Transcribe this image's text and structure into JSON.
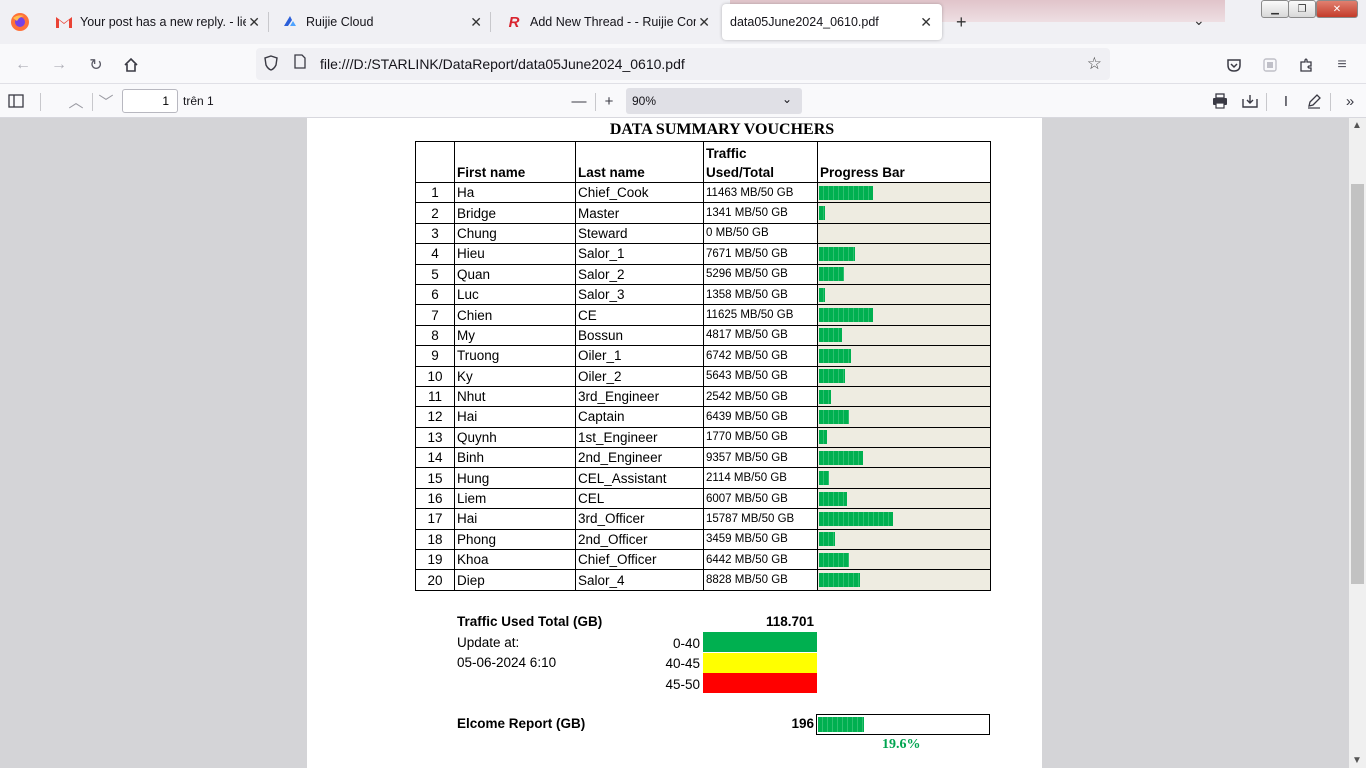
{
  "tabs": [
    {
      "title": "Your post has a new reply. - lien",
      "icon": "gmail-icon"
    },
    {
      "title": "Ruijie Cloud",
      "icon": "ruijie-cloud-icon"
    },
    {
      "title": "Add New Thread - - Ruijie Com",
      "icon": "ruijie-r-icon"
    },
    {
      "title": "data05June2024_0610.pdf",
      "icon": "pdf-icon",
      "active": true
    }
  ],
  "nav": {
    "url": "file:///D:/STARLINK/DataReport/data05June2024_0610.pdf"
  },
  "pdf_toolbar": {
    "page": "1",
    "of_label": "trên 1",
    "zoom": "90%"
  },
  "document": {
    "title": "DATA SUMMARY VOUCHERS",
    "headers": {
      "no": "",
      "first": "First name",
      "last": "Last name",
      "traffic_1": "Traffic",
      "traffic_2": "Used/Total",
      "progress": "Progress Bar"
    },
    "rows": [
      {
        "no": "1",
        "first": "Ha",
        "last": "Chief_Cook",
        "traffic": "11463 MB/50 GB",
        "used_mb": 11463
      },
      {
        "no": "2",
        "first": "Bridge",
        "last": "Master",
        "traffic": "1341 MB/50 GB",
        "used_mb": 1341
      },
      {
        "no": "3",
        "first": "Chung",
        "last": "Steward",
        "traffic": "0 MB/50 GB",
        "used_mb": 0
      },
      {
        "no": "4",
        "first": "Hieu",
        "last": "Salor_1",
        "traffic": "7671 MB/50 GB",
        "used_mb": 7671
      },
      {
        "no": "5",
        "first": "Quan",
        "last": "Salor_2",
        "traffic": "5296 MB/50 GB",
        "used_mb": 5296
      },
      {
        "no": "6",
        "first": "Luc",
        "last": "Salor_3",
        "traffic": "1358 MB/50 GB",
        "used_mb": 1358
      },
      {
        "no": "7",
        "first": "Chien",
        "last": "CE",
        "traffic": "11625 MB/50 GB",
        "used_mb": 11625
      },
      {
        "no": "8",
        "first": "My",
        "last": "Bossun",
        "traffic": "4817 MB/50 GB",
        "used_mb": 4817
      },
      {
        "no": "9",
        "first": "Truong",
        "last": "Oiler_1",
        "traffic": "6742 MB/50 GB",
        "used_mb": 6742
      },
      {
        "no": "10",
        "first": "Ky",
        "last": "Oiler_2",
        "traffic": "5643 MB/50 GB",
        "used_mb": 5643
      },
      {
        "no": "11",
        "first": "Nhut",
        "last": "3rd_Engineer",
        "traffic": "2542 MB/50 GB",
        "used_mb": 2542
      },
      {
        "no": "12",
        "first": "Hai",
        "last": "Captain",
        "traffic": "6439 MB/50 GB",
        "used_mb": 6439
      },
      {
        "no": "13",
        "first": "Quynh",
        "last": "1st_Engineer",
        "traffic": "1770 MB/50 GB",
        "used_mb": 1770
      },
      {
        "no": "14",
        "first": "Binh",
        "last": "2nd_Engineer",
        "traffic": "9357 MB/50 GB",
        "used_mb": 9357
      },
      {
        "no": "15",
        "first": "Hung",
        "last": "CEL_Assistant",
        "traffic": "2114 MB/50 GB",
        "used_mb": 2114
      },
      {
        "no": "16",
        "first": "Liem",
        "last": "CEL",
        "traffic": "6007 MB/50 GB",
        "used_mb": 6007
      },
      {
        "no": "17",
        "first": "Hai",
        "last": "3rd_Officer",
        "traffic": "15787 MB/50 GB",
        "used_mb": 15787
      },
      {
        "no": "18",
        "first": "Phong",
        "last": "2nd_Officer",
        "traffic": "3459 MB/50 GB",
        "used_mb": 3459
      },
      {
        "no": "19",
        "first": "Khoa",
        "last": "Chief_Officer",
        "traffic": "6442 MB/50 GB",
        "used_mb": 6442
      },
      {
        "no": "20",
        "first": "Diep",
        "last": "Salor_4",
        "traffic": "8828 MB/50 GB",
        "used_mb": 8828
      }
    ],
    "summary": {
      "total_label": "Traffic Used Total  (GB)",
      "total_value": "118.701",
      "update_label": "Update at:",
      "update_value": "05-06-2024 6:10",
      "legend": [
        {
          "label": "0-40",
          "color": "#00b050"
        },
        {
          "label": "40-45",
          "color": "#ffff00"
        },
        {
          "label": "45-50",
          "color": "#ff0000"
        }
      ],
      "elcome_label": "Elcome Report (GB)",
      "elcome_value": "196",
      "elcome_pct": "19.6%",
      "elcome_fraction": 0.196
    }
  }
}
